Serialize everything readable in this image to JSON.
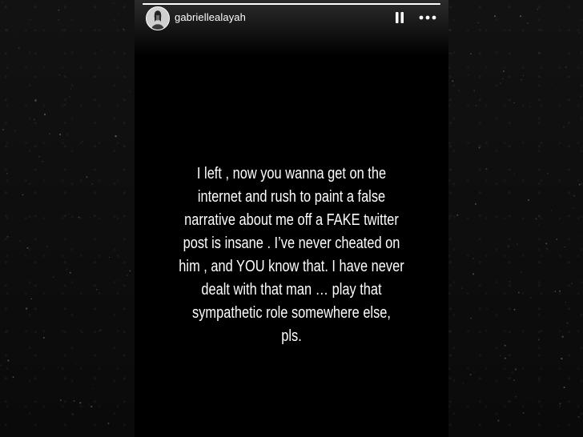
{
  "story": {
    "username": "gabriellealayah",
    "progress": 1.0,
    "message": "I left ,  now you wanna get on the\ninternet and rush to paint a false\nnarrative about me off a FAKE twitter\npost is insane . I’ve never cheated on\nhim , and YOU know that. I have never\ndealt with that man   … play that\nsympathetic role somewhere else,\npls."
  },
  "controls": {
    "pause_icon": "pause-icon",
    "more_icon": "more-horizontal-icon"
  },
  "colors": {
    "background": "#0b0b0b",
    "story_background": "#000000",
    "text": "#ffffff"
  }
}
